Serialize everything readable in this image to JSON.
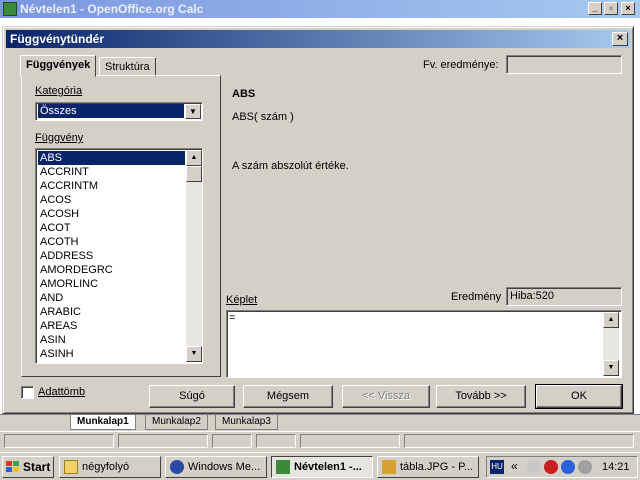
{
  "app": {
    "title": "Névtelen1 - OpenOffice.org Calc",
    "sheet_tabs": [
      "Munkalap1",
      "Munkalap2",
      "Munkalap3"
    ]
  },
  "dialog": {
    "title": "Függvénytündér",
    "tabs": [
      "Függvények",
      "Struktúra"
    ],
    "result_label": "Fv. eredménye:",
    "category_label": "Kategória",
    "category_value": "Összes",
    "function_label": "Függvény",
    "functions": [
      "ABS",
      "ACCRINT",
      "ACCRINTM",
      "ACOS",
      "ACOSH",
      "ACOT",
      "ACOTH",
      "ADDRESS",
      "AMORDEGRC",
      "AMORLINC",
      "AND",
      "ARABIC",
      "AREAS",
      "ASIN",
      "ASINH"
    ],
    "selected_function": "ABS",
    "fn_name": "ABS",
    "fn_syntax": "ABS( szám )",
    "fn_description": "A szám abszolút értéke.",
    "formula_label": "Képlet",
    "formula_value": "=",
    "eredmeny_label": "Eredmény",
    "eredmeny_value": "Hiba:520",
    "array_label": "Adattömb",
    "buttons": {
      "help": "Súgó",
      "cancel": "Mégsem",
      "back": "<< Vissza",
      "next": "Tovább >>",
      "ok": "OK"
    }
  },
  "taskbar": {
    "start": "Start",
    "items": [
      "négyfolyó",
      "Windows Me...",
      "Névtelen1 -...",
      "tábla.JPG - P..."
    ],
    "lang": "HU",
    "time": "14:21"
  },
  "colors": {
    "title_active": "#0a246a",
    "title_gradient_end": "#a6caf0",
    "face": "#d4d0c8",
    "selection": "#0a246a"
  }
}
